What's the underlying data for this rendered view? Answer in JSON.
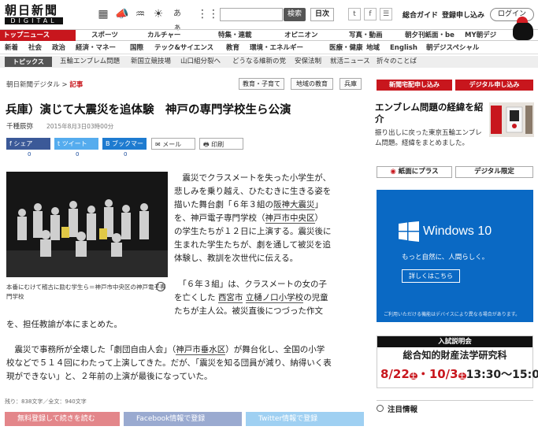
{
  "header": {
    "logo_main": "朝日新聞",
    "logo_sub": "DIGITAL",
    "search_button": "検索",
    "edition": "日次",
    "social": [
      "t",
      "f",
      "☰"
    ],
    "links": [
      "総合ガイド",
      "登録申し込み"
    ],
    "login": "ログイン"
  },
  "nav1": {
    "items": [
      "トップニュース",
      "スポーツ",
      "カルチャー",
      "特集・連載",
      "オピニオン",
      "写真・動画",
      "朝夕刊紙面・be",
      "MY朝デジ"
    ]
  },
  "nav2": {
    "items": [
      "新着",
      "社会",
      "政治",
      "経済・マネー",
      "国際",
      "テック&サイエンス",
      "教育",
      "環境・エネルギー",
      "医療・健康",
      "地域",
      "English",
      "朝デジスペシャル"
    ]
  },
  "topics": {
    "label": "トピックス",
    "items": [
      "五輪エンブレム問題",
      "新国立競技場",
      "山口組分裂へ",
      "どうなる維新の党",
      "安保法制",
      "就活ニュース",
      "折々のことば"
    ]
  },
  "breadcrumb": {
    "site": "朝日新聞デジタル",
    "sep": ">",
    "current": "記事"
  },
  "tags": [
    "教育・子育て",
    "地域の教育",
    "兵庫"
  ],
  "article": {
    "title": "兵庫）演じて大震災を追体験　神戸の専門学校生ら公演",
    "author": "千種辰弥",
    "date": "2015年8月3日03時00分",
    "share": [
      {
        "label": "シェア",
        "count": "0",
        "color": "#3b5998"
      },
      {
        "label": "ツイート",
        "count": "0",
        "color": "#55acee"
      },
      {
        "label": "ブックマーク",
        "count": "0",
        "color": "#1e7bd0"
      },
      {
        "label": "メール",
        "count": "",
        "color": "#ffffff"
      },
      {
        "label": "印刷",
        "count": "",
        "color": "#ffffff"
      }
    ],
    "caption": "本番にむけて稽古に励む学生ら＝神戸市中央区の神戸電子専門学校",
    "p1": [
      "　震災でクラスメートを失った小学生が、",
      "悲しみを乗り越え、ひたむきに生きる姿を",
      "描いた舞台劇「６年３組の",
      "」",
      "を、神戸電子専門学校（",
      "）",
      "の学生たちが１２日に上演する。震災後に",
      "生まれた学生たちが、劇を通して被災を追",
      "体験し、教訓を次世代に伝える。"
    ],
    "p1_links": [
      "阪神大震災",
      "神戸市中央区"
    ],
    "p2": [
      "　「６年３組」は、クラスメートの女の子",
      "を亡くした",
      "の児童",
      "たちが主人公。被災直後につづった作文",
      "を、担任教諭が本にまとめた。"
    ],
    "p2_links": [
      "西宮市",
      "立樋ノ口小学校"
    ],
    "p3": [
      "　震災で事務所が全壊した「劇団自由人会」（",
      "）が舞台化し、全国の小学",
      "校などで５１４回にわたって上演してきた。だが、「震災を知る団員が減り、納得いく表",
      "現ができない」と、２年前の上演が最後になっていた。"
    ],
    "p3_link": "神戸市垂水区",
    "word_count": "残り：838文字／全文：940文字",
    "bottom_buttons": [
      "無料登録して続きを読む",
      "Facebook情報で登録",
      "Twitter情報で登録"
    ]
  },
  "sidebar": {
    "red_buttons": [
      "新聞宅配申し込み",
      "デジタル申し込み"
    ],
    "emblem_title": "エンブレム問題の経緯を紹介",
    "emblem_text": "振り出しに戻った東京五輪エンブレム問題。経緯をまとめました。",
    "buttons": [
      "紙面にプラス",
      "デジタル限定"
    ],
    "ad_windows": {
      "product": "Windows 10",
      "tagline": "もっと自然に、人間らしく。",
      "cta": "詳しくはこちら",
      "footnote": "ご利用いただける機能はデバイスにより異なる場合があります。"
    },
    "seminar": {
      "head": "入試説明会",
      "title": "総合知的財産法学研究科",
      "dates": "8/22",
      "dates2": "10/3",
      "day": "土",
      "time": "13:30～15:00"
    },
    "notice": "注目情報"
  }
}
